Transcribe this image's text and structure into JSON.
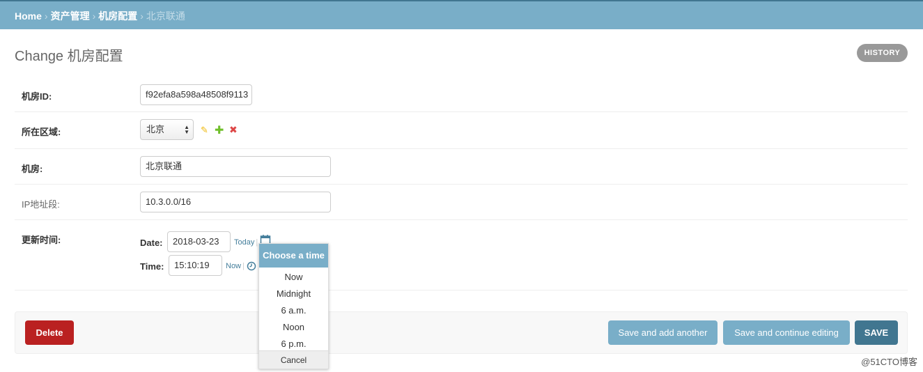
{
  "breadcrumb": {
    "home": "Home",
    "sep": "›",
    "app": "资产管理",
    "model": "机房配置",
    "current": "北京联通"
  },
  "page": {
    "title": "Change 机房配置",
    "history_label": "HISTORY"
  },
  "form": {
    "room_id": {
      "label": "机房ID:",
      "value": "f92efa8a598a48508f9113"
    },
    "region": {
      "label": "所在区域:",
      "selected": "北京"
    },
    "room": {
      "label": "机房:",
      "value": "北京联通"
    },
    "ip_range": {
      "label": "IP地址段:",
      "value": "10.3.0.0/16"
    },
    "updated": {
      "label": "更新时间:",
      "date_label": "Date:",
      "date_value": "2018-03-23",
      "today": "Today",
      "time_label": "Time:",
      "time_value": "15:10:19",
      "now": "Now",
      "bar": "|"
    }
  },
  "time_popup": {
    "caption": "Choose a time",
    "options": [
      "Now",
      "Midnight",
      "6 a.m.",
      "Noon",
      "6 p.m."
    ],
    "cancel": "Cancel"
  },
  "submit": {
    "delete": "Delete",
    "save_add": "Save and add another",
    "save_continue": "Save and continue editing",
    "save": "SAVE"
  },
  "watermark": "@51CTO博客",
  "colors": {
    "header": "#79aec8",
    "link": "#447e9b",
    "delete": "#ba2121",
    "save": "#417690",
    "edit_icon": "#efb80b",
    "add_icon": "#70bf2b",
    "delete_icon": "#dd4646"
  },
  "icons": {
    "edit": "pencil-icon",
    "add": "plus-icon",
    "remove": "x-icon",
    "calendar": "calendar-icon",
    "clock": "clock-icon"
  }
}
